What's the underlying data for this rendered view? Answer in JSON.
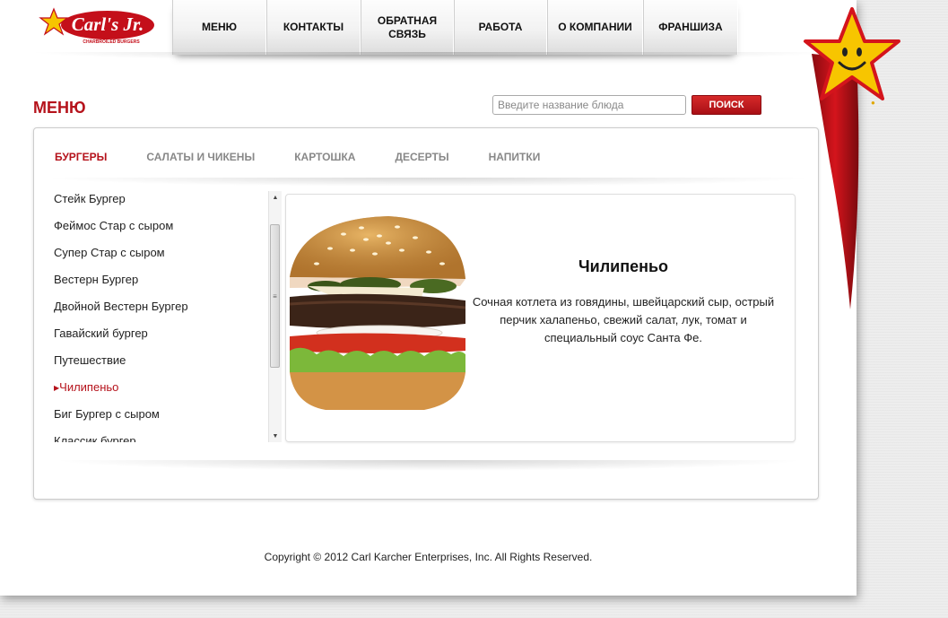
{
  "header": {
    "logo_text": "Carl's Jr.",
    "logo_tagline": "CHARBROILED BURGERS",
    "nav": [
      {
        "label": "МЕНЮ"
      },
      {
        "label": "КОНТАКТЫ"
      },
      {
        "label": "ОБРАТНАЯ СВЯЗЬ"
      },
      {
        "label": "РАБОТА"
      },
      {
        "label": "О КОМПАНИИ"
      },
      {
        "label": "ФРАНШИЗА"
      }
    ]
  },
  "page": {
    "title": "МЕНЮ"
  },
  "search": {
    "placeholder": "Введите название блюда",
    "button_label": "ПОИСК"
  },
  "tabs": [
    {
      "label": "БУРГЕРЫ",
      "active": true
    },
    {
      "label": "САЛАТЫ И ЧИКЕНЫ",
      "active": false
    },
    {
      "label": "КАРТОШКА",
      "active": false
    },
    {
      "label": "ДЕСЕРТЫ",
      "active": false
    },
    {
      "label": "НАПИТКИ",
      "active": false
    }
  ],
  "menu_items": [
    {
      "label": "Стейк Бургер"
    },
    {
      "label": "Феймос Стар с сыром"
    },
    {
      "label": "Супер Стар с сыром"
    },
    {
      "label": "Вестерн Бургер"
    },
    {
      "label": "Двойной Вестерн Бургер"
    },
    {
      "label": "Гавайский бургер"
    },
    {
      "label": "Путешествие"
    },
    {
      "label": "Чилипеньо"
    },
    {
      "label": "Биг Бургер с сыром"
    },
    {
      "label": "Классик бургер"
    }
  ],
  "selected_item_index": 7,
  "detail": {
    "name": "Чилипеньо",
    "description": "Сочная котлета из говядины, швейцарский сыр, острый перчик халапеньо, свежий салат, лук, томат и специальный соус Санта Фе."
  },
  "footer": {
    "copyright": "Copyright © 2012 Carl Karcher Enterprises, Inc. All Rights Reserved."
  },
  "colors": {
    "brand_red": "#b5121b",
    "star_yellow": "#f7c500",
    "tab_inactive": "#888888"
  }
}
